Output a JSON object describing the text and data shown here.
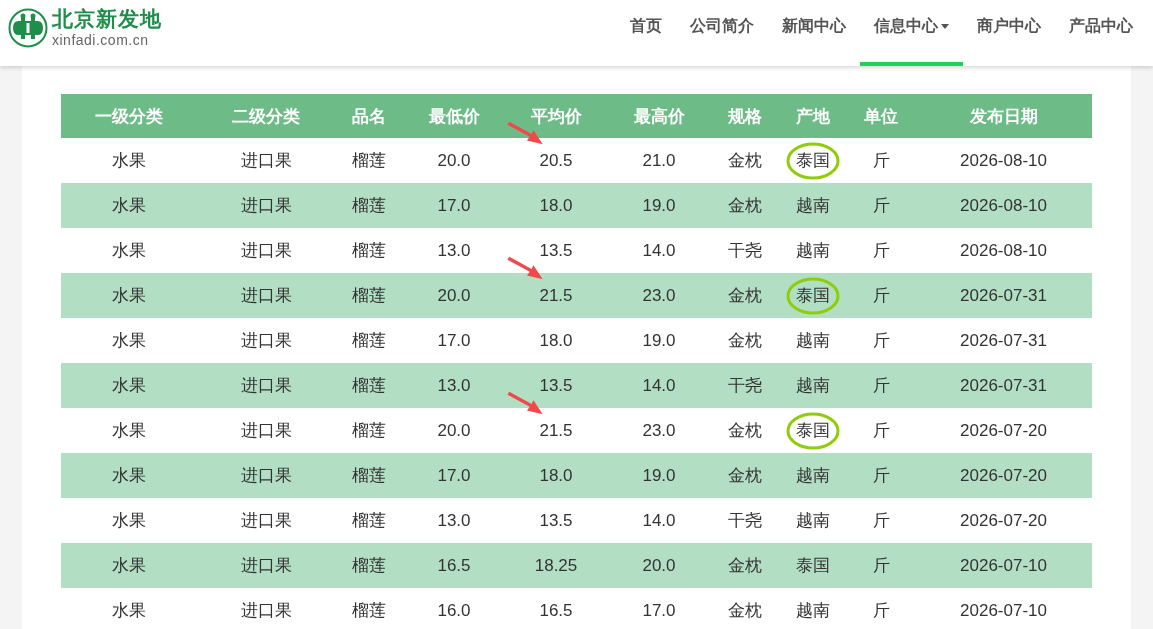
{
  "logo": {
    "name": "北京新发地",
    "domain": "xinfadi.com.cn"
  },
  "nav": [
    {
      "label": "首页",
      "selected": false,
      "dropdown": false
    },
    {
      "label": "公司简介",
      "selected": false,
      "dropdown": false
    },
    {
      "label": "新闻中心",
      "selected": false,
      "dropdown": false
    },
    {
      "label": "信息中心",
      "selected": true,
      "dropdown": true
    },
    {
      "label": "商户中心",
      "selected": false,
      "dropdown": false
    },
    {
      "label": "产品中心",
      "selected": false,
      "dropdown": false
    }
  ],
  "table": {
    "columns": [
      "一级分类",
      "二级分类",
      "品名",
      "最低价",
      "平均价",
      "最高价",
      "规格",
      "产地",
      "单位",
      "发布日期"
    ],
    "rows": [
      {
        "cells": [
          "水果",
          "进口果",
          "榴莲",
          "20.0",
          "20.5",
          "21.0",
          "金枕",
          "泰国",
          "斤",
          "2026-08-10"
        ],
        "arrow": true,
        "circled": true
      },
      {
        "cells": [
          "水果",
          "进口果",
          "榴莲",
          "17.0",
          "18.0",
          "19.0",
          "金枕",
          "越南",
          "斤",
          "2026-08-10"
        ],
        "arrow": false,
        "circled": false
      },
      {
        "cells": [
          "水果",
          "进口果",
          "榴莲",
          "13.0",
          "13.5",
          "14.0",
          "干尧",
          "越南",
          "斤",
          "2026-08-10"
        ],
        "arrow": false,
        "circled": false
      },
      {
        "cells": [
          "水果",
          "进口果",
          "榴莲",
          "20.0",
          "21.5",
          "23.0",
          "金枕",
          "泰国",
          "斤",
          "2026-07-31"
        ],
        "arrow": true,
        "circled": true
      },
      {
        "cells": [
          "水果",
          "进口果",
          "榴莲",
          "17.0",
          "18.0",
          "19.0",
          "金枕",
          "越南",
          "斤",
          "2026-07-31"
        ],
        "arrow": false,
        "circled": false
      },
      {
        "cells": [
          "水果",
          "进口果",
          "榴莲",
          "13.0",
          "13.5",
          "14.0",
          "干尧",
          "越南",
          "斤",
          "2026-07-31"
        ],
        "arrow": false,
        "circled": false
      },
      {
        "cells": [
          "水果",
          "进口果",
          "榴莲",
          "20.0",
          "21.5",
          "23.0",
          "金枕",
          "泰国",
          "斤",
          "2026-07-20"
        ],
        "arrow": true,
        "circled": true
      },
      {
        "cells": [
          "水果",
          "进口果",
          "榴莲",
          "17.0",
          "18.0",
          "19.0",
          "金枕",
          "越南",
          "斤",
          "2026-07-20"
        ],
        "arrow": false,
        "circled": false
      },
      {
        "cells": [
          "水果",
          "进口果",
          "榴莲",
          "13.0",
          "13.5",
          "14.0",
          "干尧",
          "越南",
          "斤",
          "2026-07-20"
        ],
        "arrow": false,
        "circled": false
      },
      {
        "cells": [
          "水果",
          "进口果",
          "榴莲",
          "16.5",
          "18.25",
          "20.0",
          "金枕",
          "泰国",
          "斤",
          "2026-07-10"
        ],
        "arrow": false,
        "circled": false
      },
      {
        "cells": [
          "水果",
          "进口果",
          "榴莲",
          "16.0",
          "16.5",
          "17.0",
          "金枕",
          "越南",
          "斤",
          "2026-07-10"
        ],
        "arrow": false,
        "circled": false
      }
    ]
  }
}
